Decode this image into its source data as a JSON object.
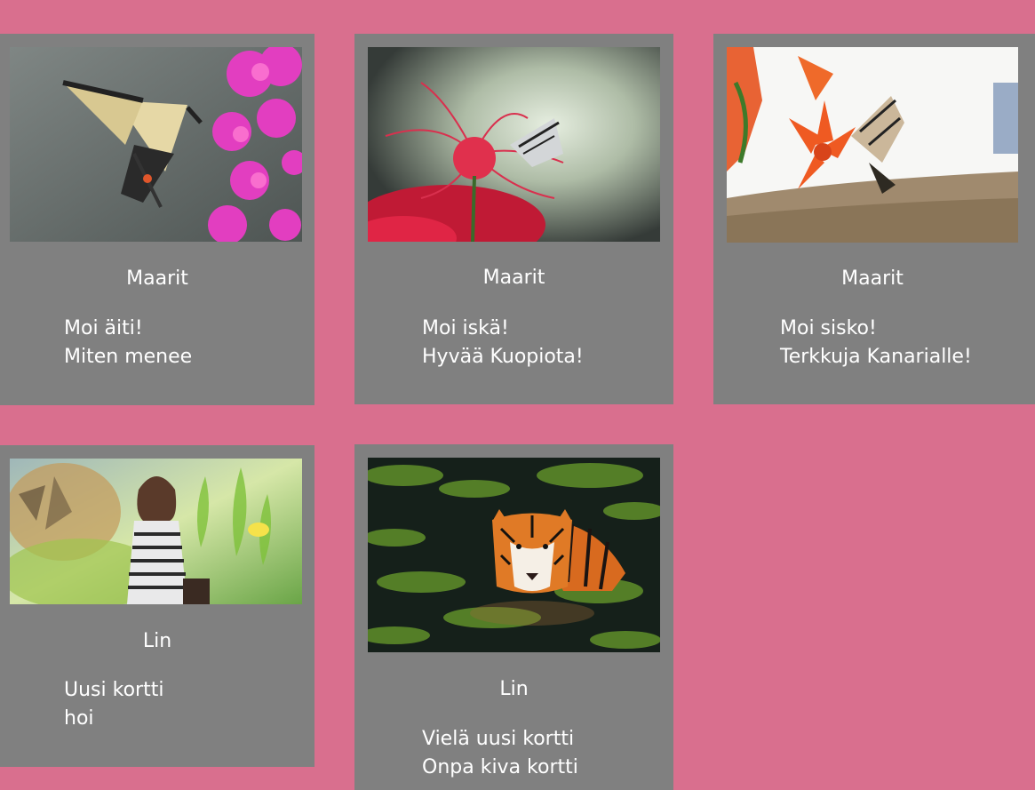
{
  "cards": [
    {
      "image": "swallowtail-butterfly-on-pink-phlox",
      "sender": "Maarit",
      "lines": [
        "Moi äiti!",
        "Miten menee"
      ]
    },
    {
      "image": "butterfly-on-red-spider-lily",
      "sender": "Maarit",
      "lines": [
        "Moi iskä!",
        "Hyvää Kuopiota!"
      ]
    },
    {
      "image": "butterfly-on-orange-tiger-lily",
      "sender": "Maarit",
      "lines": [
        "Moi sisko!",
        "Terkkuja Kanarialle!"
      ]
    },
    {
      "image": "woman-with-tiger-fantasy-collage",
      "sender": "Lin",
      "lines": [
        "Uusi kortti",
        "hoi"
      ]
    },
    {
      "image": "tiger-swimming-in-pond",
      "sender": "Lin",
      "lines": [
        "Vielä uusi kortti",
        "Onpa kiva kortti"
      ]
    }
  ],
  "colors": {
    "background": "#d96f8e",
    "card": "#808080",
    "text": "#ffffff"
  }
}
